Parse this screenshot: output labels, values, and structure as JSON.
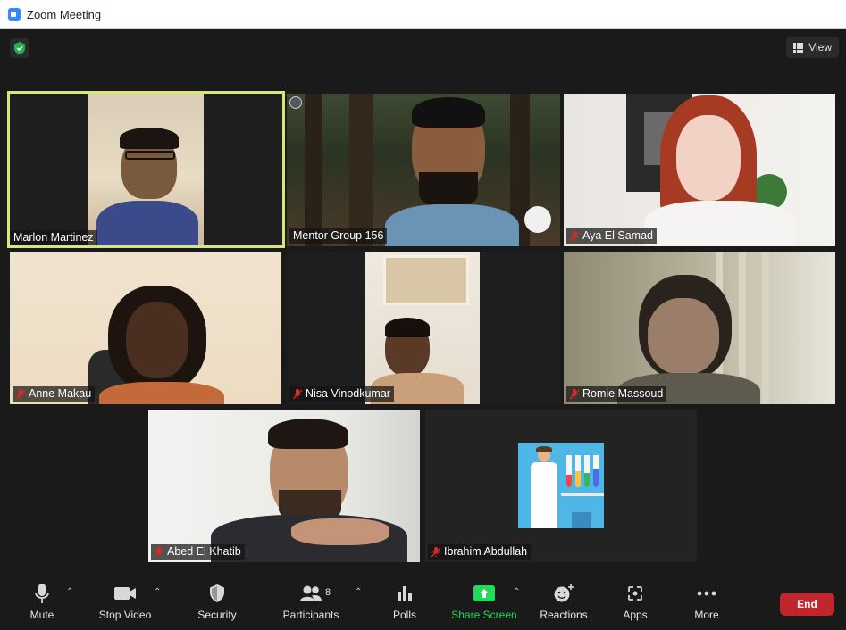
{
  "window": {
    "title": "Zoom Meeting"
  },
  "header": {
    "view_label": "View"
  },
  "participants": [
    {
      "name": "Marlon Martinez",
      "muted": false,
      "active_speaker": true
    },
    {
      "name": "Mentor Group 156",
      "muted": false,
      "active_speaker": false
    },
    {
      "name": "Aya El Samad",
      "muted": true,
      "active_speaker": false
    },
    {
      "name": "Anne Makau",
      "muted": true,
      "active_speaker": false
    },
    {
      "name": "Nisa Vinodkumar",
      "muted": true,
      "active_speaker": false
    },
    {
      "name": "Romie Massoud",
      "muted": true,
      "active_speaker": false
    },
    {
      "name": "Abed El Khatib",
      "muted": true,
      "active_speaker": false
    },
    {
      "name": "Ibrahim Abdullah",
      "muted": true,
      "active_speaker": false
    }
  ],
  "toolbar": {
    "mute_label": "Mute",
    "stop_video_label": "Stop Video",
    "security_label": "Security",
    "participants_label": "Participants",
    "participants_count": "8",
    "polls_label": "Polls",
    "share_screen_label": "Share Screen",
    "reactions_label": "Reactions",
    "apps_label": "Apps",
    "more_label": "More",
    "end_label": "End"
  },
  "colors": {
    "active_speaker_border": "#d6e67a",
    "share_screen_green": "#23d959",
    "end_button": "#c2262d",
    "muted_red": "#e02828",
    "background": "#1a1a1a"
  }
}
